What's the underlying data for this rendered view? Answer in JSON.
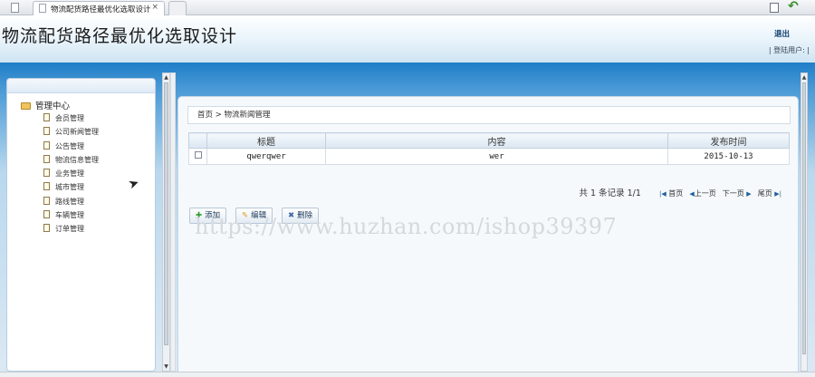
{
  "browser": {
    "tab_title": "物流配货路径最优化选取设计",
    "tab_close": "×"
  },
  "header": {
    "title": "物流配货路径最优化选取设计",
    "logout": "退出",
    "user_line": "| 登陆用户: |"
  },
  "sidebar": {
    "root_label": "管理中心",
    "items": [
      {
        "label": "会员管理"
      },
      {
        "label": "公司新闻管理"
      },
      {
        "label": "公告管理"
      },
      {
        "label": "物流信息管理"
      },
      {
        "label": "业务管理"
      },
      {
        "label": "城市管理"
      },
      {
        "label": "路线管理"
      },
      {
        "label": "车辆管理"
      },
      {
        "label": "订单管理"
      }
    ]
  },
  "main": {
    "breadcrumb": "首页 > 物流新闻管理",
    "table": {
      "columns": [
        "标题",
        "内容",
        "发布时间"
      ],
      "rows": [
        {
          "title": "qwerqwer",
          "content": "wer",
          "date": "2015-10-13"
        }
      ]
    },
    "pager": {
      "summary": "共 1 条记录 1/1",
      "first": "首页",
      "prev": "上一页",
      "next": "下一页",
      "last": "尾页"
    },
    "actions": {
      "add": "添加",
      "edit": "编辑",
      "delete": "删除"
    }
  },
  "watermark": "https://www.huzhan.com/ishop39397",
  "colors": {
    "band_blue": "#1f7ec8",
    "panel_bg": "#f6f9fc",
    "header_text": "#0d3d6e"
  }
}
